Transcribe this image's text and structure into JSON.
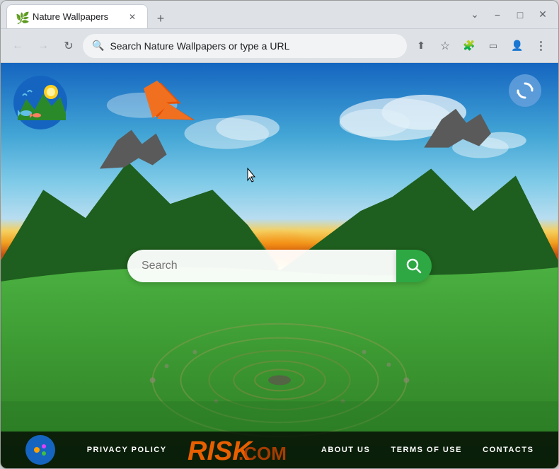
{
  "browser": {
    "tab": {
      "title": "Nature Wallpapers",
      "favicon": "🌿"
    },
    "new_tab_label": "+",
    "window_controls": {
      "minimize": "−",
      "maximize": "□",
      "close": "✕",
      "chevron_down": "⌄"
    },
    "address_bar": {
      "placeholder": "Search Nature Wallpapers or type a URL",
      "value": "Search Nature Wallpapers or type a URL"
    },
    "nav": {
      "back_label": "←",
      "forward_label": "→",
      "refresh_label": "↻"
    },
    "nav_actions": {
      "share": "⬆",
      "bookmark": "☆",
      "extensions": "🧩",
      "sidebar": "⬜",
      "profile": "👤",
      "menu": "⋮"
    }
  },
  "content": {
    "search_placeholder": "Search",
    "search_button_label": "🔍",
    "refresh_icon_label": "↻"
  },
  "footer": {
    "privacy_policy": "PRIVACY POLICY",
    "about_us": "ABOUT US",
    "terms_of_use": "TERMS OF USE",
    "contacts": "CONTACTS",
    "brand": "RISK.COM"
  },
  "colors": {
    "search_btn_bg": "#2da843",
    "accent_orange": "#ff6600",
    "tab_bg": "#ffffff",
    "chrome_bg": "#dee1e6",
    "refresh_circle": "#5b9fd6"
  }
}
